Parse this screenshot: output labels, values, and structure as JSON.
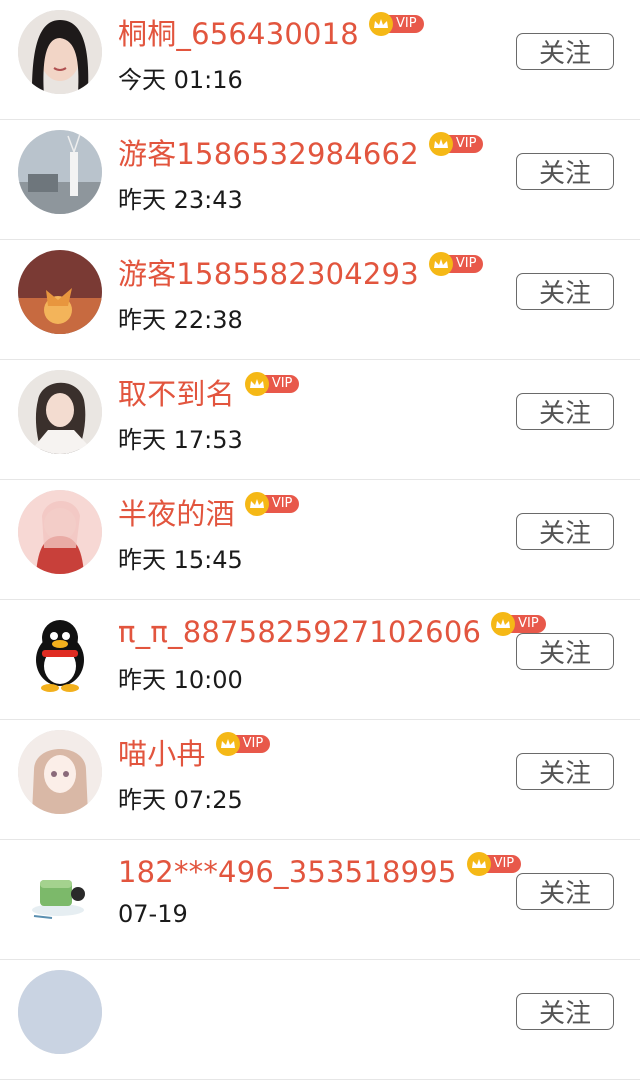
{
  "follow_label": "关注",
  "vip_label": "VIP",
  "colors": {
    "name": "#e2553e",
    "vip_crown": "#f5b816",
    "vip_tag": "#e8584a"
  },
  "users": [
    {
      "name": "桐桐_656430018",
      "time": "今天 01:16",
      "avatar": "woman-photo-avatar"
    },
    {
      "name": "游客1586532984662",
      "time": "昨天 23:43",
      "avatar": "vase-interior-avatar"
    },
    {
      "name": "游客1585582304293",
      "time": "昨天 22:38",
      "avatar": "butterfly-art-avatar"
    },
    {
      "name": "取不到名",
      "time": "昨天 17:53",
      "avatar": "illustrated-girl-avatar"
    },
    {
      "name": "半夜的酒",
      "time": "昨天 15:45",
      "avatar": "anime-girl-avatar"
    },
    {
      "name": "π_π_8875825927102606",
      "time": "昨天 10:00",
      "avatar": "qq-penguin-avatar"
    },
    {
      "name": "喵小冉",
      "time": "昨天 07:25",
      "avatar": "sketch-girl-avatar"
    },
    {
      "name": "182***496_353518995",
      "time": "07-19",
      "avatar": "cake-avatar"
    }
  ]
}
